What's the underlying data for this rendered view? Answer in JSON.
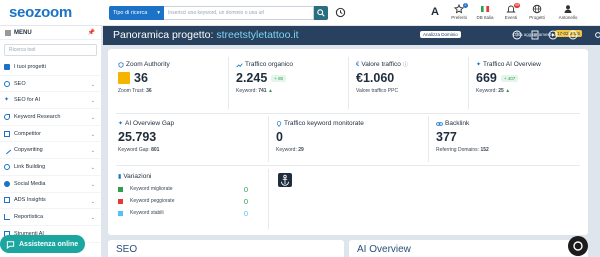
{
  "brand": {
    "logo_text": "seozoom",
    "accent": "#1b72c7"
  },
  "search": {
    "type_label": "Tipo di ricerca",
    "placeholder": "Inserisci una keyword, un dominio o una url"
  },
  "toolbar": {
    "font_label": "A",
    "items": [
      {
        "label": "Preferiti",
        "icon": "star-icon",
        "badge": "2"
      },
      {
        "label": "DB Italia",
        "icon": "flag-icon"
      },
      {
        "label": "Eventi",
        "icon": "bell-icon",
        "badge": "99"
      },
      {
        "label": "Progetti",
        "icon": "globe-icon"
      },
      {
        "label": "Antonello",
        "icon": "user-icon"
      }
    ]
  },
  "sidebar": {
    "menu_label": "MENU",
    "search_placeholder": "Ricerca tool",
    "items": [
      {
        "label": "I tuoi progetti",
        "icon": "grid-icon"
      },
      {
        "label": "SEO",
        "icon": "seo-icon"
      },
      {
        "label": "SEO for AI",
        "icon": "ai-icon"
      },
      {
        "label": "Keyword Research",
        "icon": "key-icon"
      },
      {
        "label": "Competitor",
        "icon": "competitor-icon"
      },
      {
        "label": "Copywriting",
        "icon": "pen-icon"
      },
      {
        "label": "Link Building",
        "icon": "link-icon"
      },
      {
        "label": "Social Media",
        "icon": "social-icon"
      },
      {
        "label": "ADS Insights",
        "icon": "ads-icon"
      },
      {
        "label": "Reportistica",
        "icon": "report-icon"
      },
      {
        "label": "Strumenti AI",
        "icon": "tools-icon"
      }
    ],
    "assist_label": "Assistenza online"
  },
  "header": {
    "title_prefix": "Panoramica progetto: ",
    "domain": "streetstyletattoo.it",
    "badge": "Analizza Dominio",
    "update_label": "Data aggiornamento:",
    "update_date": "17-02-2026"
  },
  "cards": {
    "zoom_authority": {
      "label": "Zoom Authority",
      "value": "36",
      "sub_label": "Zoom Trust:",
      "sub_value": "36"
    },
    "organic_traffic": {
      "label": "Traffico organico",
      "value": "2.245",
      "delta": "+ 80",
      "sub_label": "Keyword:",
      "sub_value": "741"
    },
    "traffic_value": {
      "label": "Valore traffico",
      "value": "€1.060",
      "sub_label": "Valore traffico PPC"
    },
    "ai_overview_traffic": {
      "label": "Traffico AI Overview",
      "value": "669",
      "delta": "+ 407",
      "sub_label": "Keyword:",
      "sub_value": "25"
    },
    "ai_overview_gap": {
      "label": "AI Overview Gap",
      "value": "25.793",
      "sub_label": "Keyword Gap:",
      "sub_value": "801"
    },
    "monitored_traffic": {
      "label": "Traffico keyword monitorate",
      "value": "0",
      "sub_label": "Keyword:",
      "sub_value": "29"
    },
    "backlink": {
      "label": "Backlink",
      "value": "377",
      "sub_label": "Referring Domains:",
      "sub_value": "152"
    }
  },
  "variations": {
    "title": "Variazioni",
    "rows": [
      {
        "label": "Keyword migliorate",
        "value": "0",
        "color": "#2e9e4f"
      },
      {
        "label": "Keyword peggiorate",
        "value": "0",
        "color": "#e53935"
      },
      {
        "label": "Keyword stabili",
        "value": "0",
        "color": "#4fc3f7"
      }
    ]
  },
  "bottom": {
    "seo_title": "SEO",
    "ai_title": "AI Overview"
  }
}
